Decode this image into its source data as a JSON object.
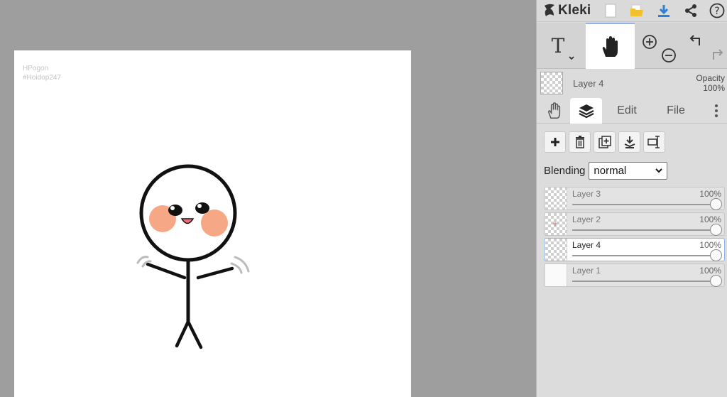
{
  "app": {
    "name": "Kleki"
  },
  "canvas": {
    "watermark_line1": "HPogon",
    "watermark_line2": "#Hoidop247"
  },
  "topbar": {
    "icons": [
      "kleki-logo-icon",
      "new-image-icon",
      "open-folder-icon",
      "download-icon",
      "share-icon",
      "help-icon"
    ]
  },
  "tools": {
    "items": [
      "text-tool-icon",
      "hand-tool-icon",
      "zoom-in-icon",
      "zoom-out-icon",
      "undo-icon",
      "redo-icon"
    ],
    "active": "hand"
  },
  "current_layer": {
    "name": "Layer 4",
    "opacity_label": "Opacity",
    "opacity_value": "100%"
  },
  "tabs": {
    "items": [
      "hand-tab-icon",
      "layers-tab-icon"
    ],
    "edit_label": "Edit",
    "file_label": "File",
    "active": "layers"
  },
  "layer_actions": [
    "add-layer-icon",
    "delete-layer-icon",
    "duplicate-layer-icon",
    "merge-down-icon",
    "rename-layer-icon"
  ],
  "blending": {
    "label": "Blending",
    "value": "normal"
  },
  "layers": [
    {
      "name": "Layer 3",
      "opacity": "100%",
      "selected": false
    },
    {
      "name": "Layer 2",
      "opacity": "100%",
      "selected": false
    },
    {
      "name": "Layer 4",
      "opacity": "100%",
      "selected": true
    },
    {
      "name": "Layer 1",
      "opacity": "100%",
      "selected": false
    }
  ],
  "colors": {
    "accent": "#2a7fd6",
    "folder": "#f2c22e",
    "panel_bg": "#dcdcdc",
    "workspace_bg": "#9e9e9e",
    "blush": "#f6a886",
    "mouth": "#f06c7b"
  }
}
